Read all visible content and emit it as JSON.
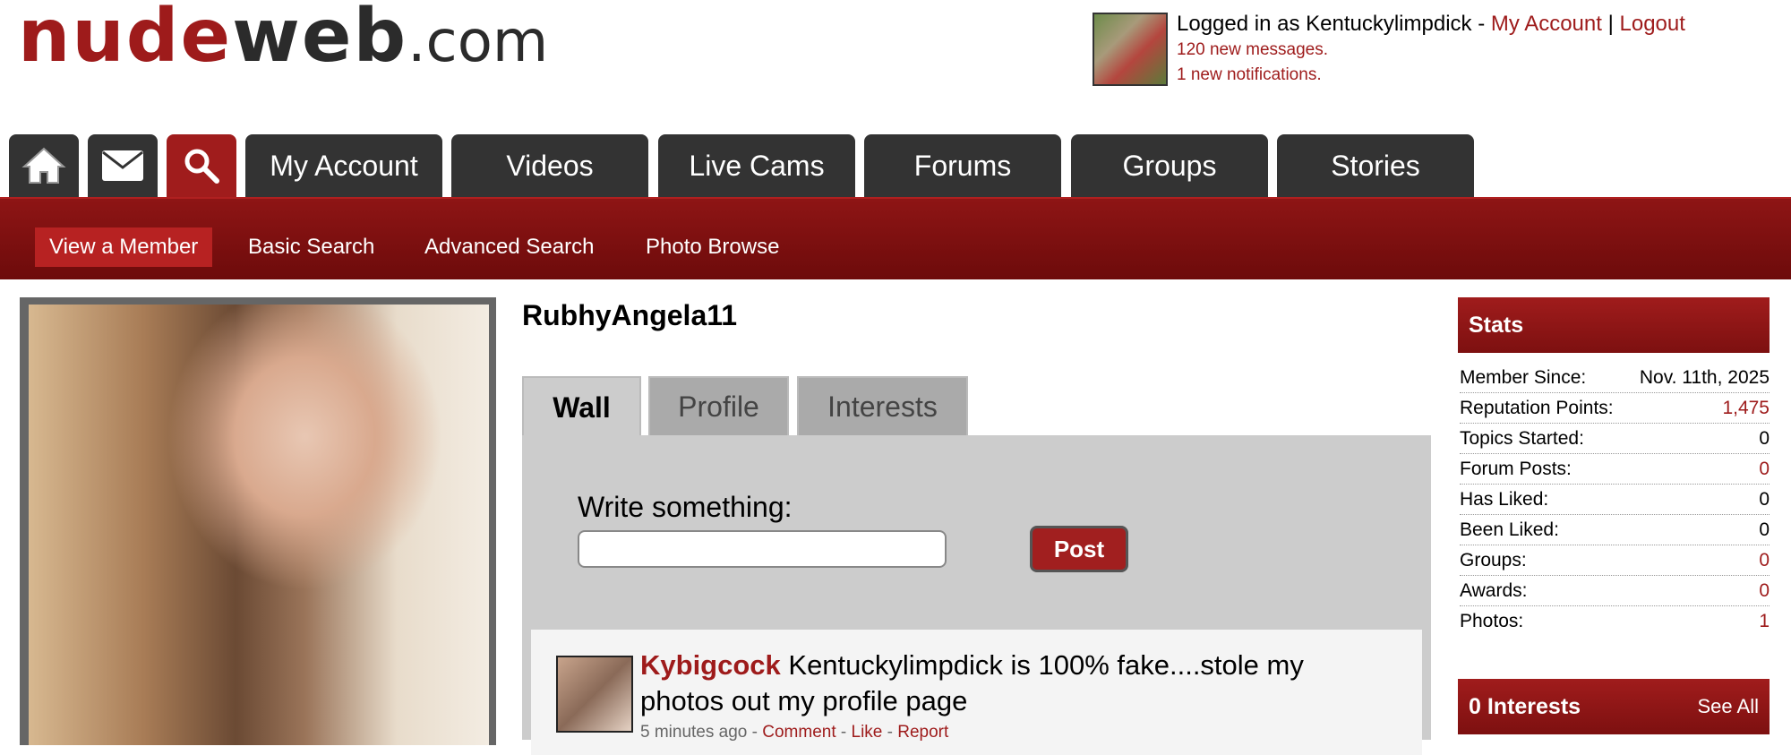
{
  "logo": {
    "part1": "nude",
    "part2": "web",
    "part3": ".com"
  },
  "header": {
    "logged_in_prefix": "Logged in as Kentuckylimpdick - ",
    "my_account": "My Account",
    "separator": " | ",
    "logout": "Logout",
    "messages": "120 new messages.",
    "notifications": "1 new notifications."
  },
  "nav": {
    "home_icon": "home-icon",
    "mail_icon": "mail-icon",
    "search_icon": "search-icon",
    "tabs": [
      "My Account",
      "Videos",
      "Live Cams",
      "Forums",
      "Groups",
      "Stories"
    ]
  },
  "subnav": [
    "View a Member",
    "Basic Search",
    "Advanced Search",
    "Photo Browse"
  ],
  "member": {
    "name": "RubhyAngela11"
  },
  "profile_tabs": [
    "Wall",
    "Profile",
    "Interests"
  ],
  "wall": {
    "write_label": "Write something:",
    "input_value": "",
    "post_label": "Post"
  },
  "post": {
    "author": "Kybigcock",
    "text": " Kentuckylimpdick is 100% fake....stole my photos out my profile page",
    "time": "5 minutes ago - ",
    "comment": "Comment",
    "like": "Like",
    "report": "Report",
    "sep": " - "
  },
  "stats": {
    "title": "Stats",
    "rows": [
      {
        "label": "Member Since:",
        "value": "Nov. 11th, 2025"
      },
      {
        "label": "Reputation Points:",
        "value": "1,475"
      },
      {
        "label": "Topics Started:",
        "value": "0"
      },
      {
        "label": "Forum Posts:",
        "value": "0"
      },
      {
        "label": "Has Liked:",
        "value": "0"
      },
      {
        "label": "Been Liked:",
        "value": "0"
      },
      {
        "label": "Groups:",
        "value": "0"
      },
      {
        "label": "Awards:",
        "value": "0"
      },
      {
        "label": "Photos:",
        "value": "1"
      }
    ]
  },
  "interests": {
    "title": "0 Interests",
    "see_all": "See All"
  },
  "colors": {
    "brand_red": "#9e1b1b",
    "tab_dark": "#333333",
    "subnav_red": "#8e1515"
  }
}
